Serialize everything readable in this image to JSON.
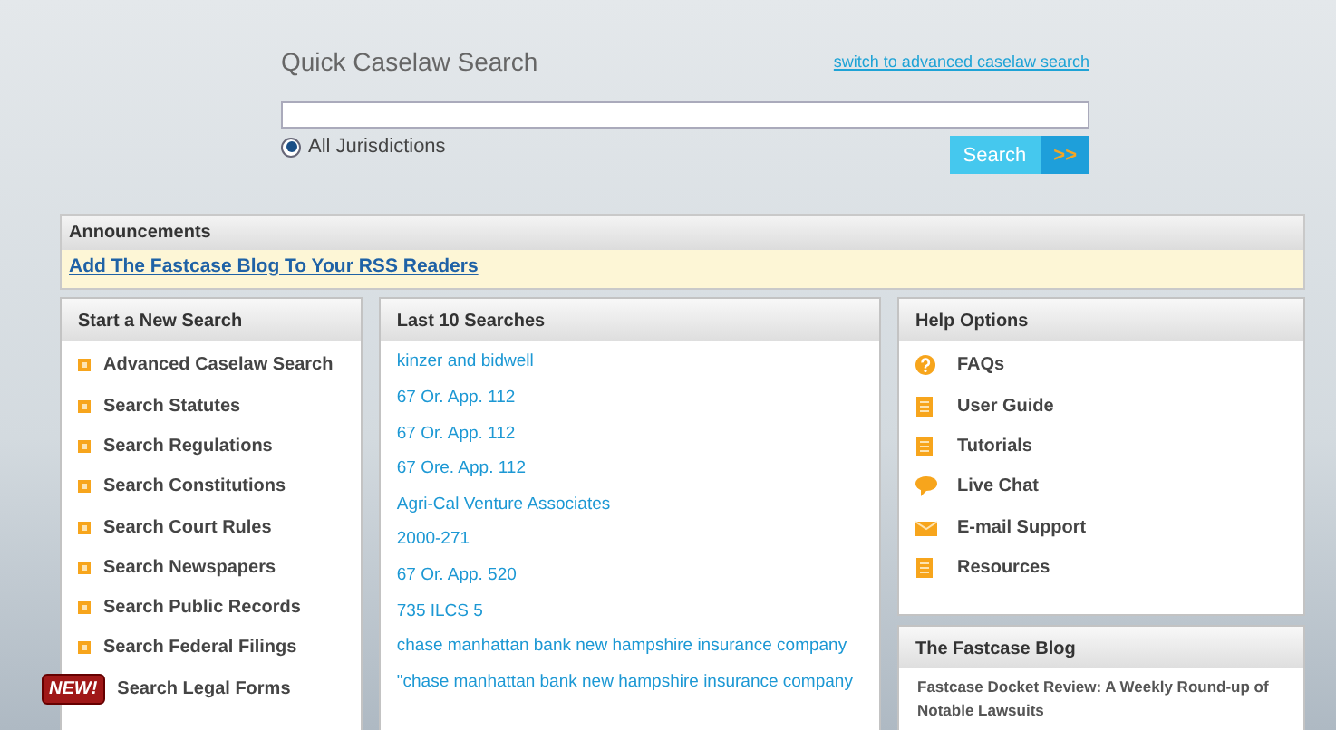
{
  "quick_search": {
    "title": "Quick Caselaw Search",
    "advanced_link": "switch to advanced caselaw search",
    "jurisdiction": {
      "label": "All Jurisdictions",
      "selected": true
    },
    "button": "Search",
    "button_arrow": ">>"
  },
  "announcements": {
    "title": "Announcements",
    "link": "Add The Fastcase Blog To Your RSS Readers"
  },
  "start_search": {
    "title": "Start a New Search",
    "items": [
      {
        "label": "Advanced Caselaw Search",
        "kind": "bullet"
      },
      {
        "label": "Search Statutes",
        "kind": "bullet"
      },
      {
        "label": "Search Regulations",
        "kind": "bullet"
      },
      {
        "label": "Search Constitutions",
        "kind": "bullet"
      },
      {
        "label": "Search Court Rules",
        "kind": "bullet"
      },
      {
        "label": "Search Newspapers",
        "kind": "bullet"
      },
      {
        "label": "Search Public Records",
        "kind": "bullet"
      },
      {
        "label": "Search Federal Filings",
        "kind": "bullet"
      },
      {
        "label": "Search Legal Forms",
        "kind": "new",
        "badge": "NEW!"
      }
    ]
  },
  "last_searches": {
    "title": "Last 10 Searches",
    "items": [
      "kinzer and bidwell",
      "67 Or. App. 112",
      "67 Or. App. 112",
      "67 Ore. App. 112",
      "Agri-Cal Venture Associates",
      "2000-271",
      "67 Or. App. 520",
      "735 ILCS 5",
      "chase manhattan bank new hampshire insurance company",
      "\"chase manhattan bank new hampshire insurance company"
    ]
  },
  "help": {
    "title": "Help Options",
    "items": [
      {
        "label": "FAQs",
        "kind": "question"
      },
      {
        "label": "User Guide",
        "kind": "document"
      },
      {
        "label": "Tutorials",
        "kind": "document"
      },
      {
        "label": "Live Chat",
        "kind": "chat"
      },
      {
        "label": "E-mail Support",
        "kind": "mail"
      },
      {
        "label": "Resources",
        "kind": "document"
      }
    ]
  },
  "blog": {
    "title": "The Fastcase Blog",
    "posts": [
      "Fastcase Docket Review: A Weekly Round-up of Notable Lawsuits"
    ]
  }
}
